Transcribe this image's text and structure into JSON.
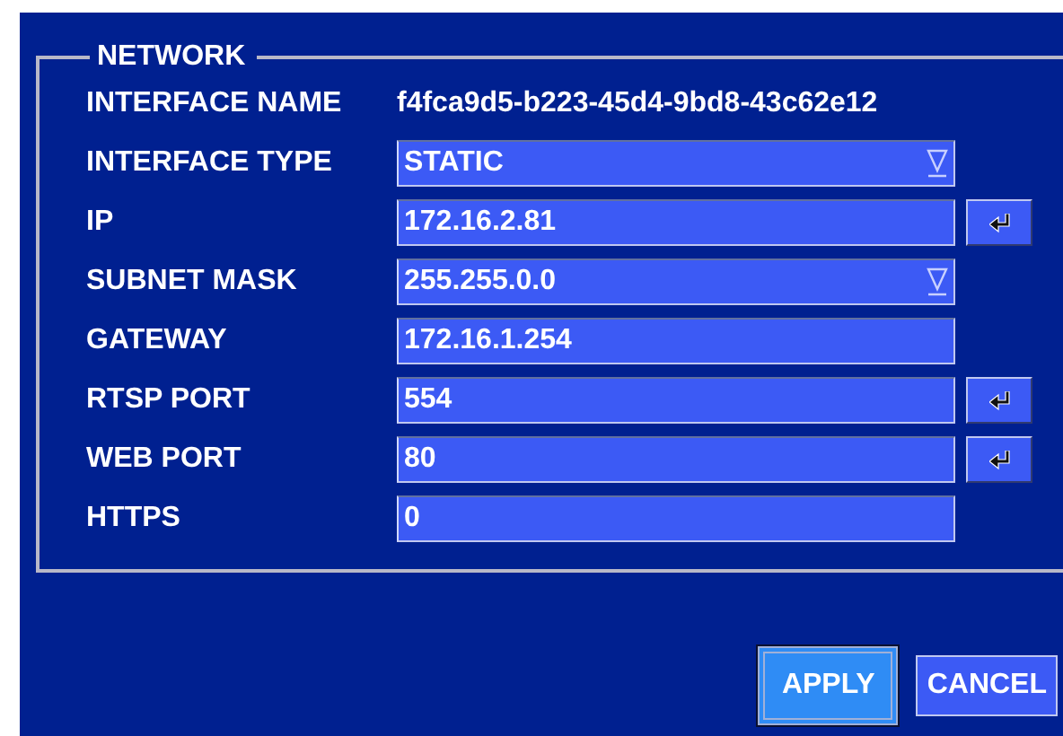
{
  "section": {
    "title": "NETWORK"
  },
  "rows": [
    {
      "label": "INTERFACE NAME",
      "kind": "text",
      "value": "f4fca9d5-b223-45d4-9bd8-43c62e12",
      "enter": false
    },
    {
      "label": "INTERFACE TYPE",
      "kind": "select",
      "value": "STATIC",
      "enter": false
    },
    {
      "label": "IP",
      "kind": "input",
      "value": "172.16.2.81",
      "enter": true
    },
    {
      "label": "SUBNET MASK",
      "kind": "select",
      "value": "255.255.0.0",
      "enter": false
    },
    {
      "label": "GATEWAY",
      "kind": "input",
      "value": "172.16.1.254",
      "enter": false
    },
    {
      "label": "RTSP PORT",
      "kind": "input",
      "value": "554",
      "enter": true
    },
    {
      "label": "WEB PORT",
      "kind": "input",
      "value": "80",
      "enter": true
    },
    {
      "label": "HTTPS",
      "kind": "input",
      "value": "0",
      "enter": false
    }
  ],
  "buttons": [
    {
      "label": "APPLY",
      "selected": true
    },
    {
      "label": "CANCEL",
      "selected": false
    }
  ]
}
